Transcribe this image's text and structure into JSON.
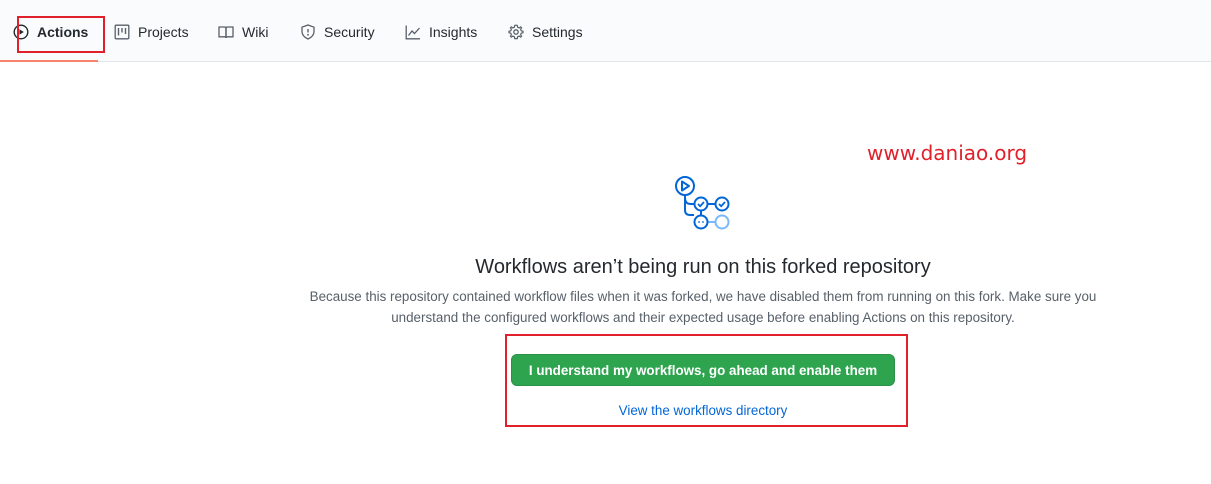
{
  "tabs": [
    {
      "label": "Actions",
      "icon": "play-icon",
      "selected": true
    },
    {
      "label": "Projects",
      "icon": "project-icon",
      "selected": false
    },
    {
      "label": "Wiki",
      "icon": "book-icon",
      "selected": false
    },
    {
      "label": "Security",
      "icon": "shield-icon",
      "selected": false
    },
    {
      "label": "Insights",
      "icon": "graph-icon",
      "selected": false
    },
    {
      "label": "Settings",
      "icon": "gear-icon",
      "selected": false
    }
  ],
  "watermark": "www.daniao.org",
  "blankslate": {
    "title": "Workflows aren’t being run on this forked repository",
    "description": "Because this repository contained workflow files when it was forked, we have disabled them from running on this fork. Make sure you understand the configured workflows and their expected usage before enabling Actions on this repository.",
    "enable_button": "I understand my workflows, go ahead and enable them",
    "view_link": "View the workflows directory"
  },
  "colors": {
    "accent_underline": "#f9826c",
    "button_green": "#2ea44f",
    "link_blue": "#0366d6",
    "annotation_red": "#e0202a"
  }
}
